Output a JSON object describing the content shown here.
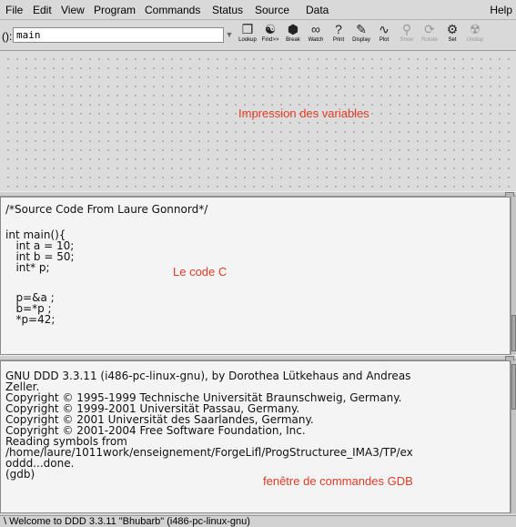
{
  "menubar": {
    "items": [
      "File",
      "Edit",
      "View",
      "Program",
      "Commands",
      "Status",
      "Source",
      "Data"
    ],
    "help": "Help"
  },
  "toolbar": {
    "arg_label": "():",
    "arg_value": "main",
    "buttons": [
      {
        "label": "Lookup",
        "icon": "magnifier-icon",
        "enabled": true
      },
      {
        "label": "Find>>",
        "icon": "binoculars-icon",
        "enabled": true
      },
      {
        "label": "Break",
        "icon": "stop-sign-icon",
        "enabled": true
      },
      {
        "label": "Watch",
        "icon": "glasses-icon",
        "enabled": true
      },
      {
        "label": "Print",
        "icon": "question-icon",
        "enabled": true
      },
      {
        "label": "Display",
        "icon": "display-icon",
        "enabled": true
      },
      {
        "label": "Plot",
        "icon": "plot-icon",
        "enabled": true
      },
      {
        "label": "Show",
        "icon": "show-icon",
        "enabled": false
      },
      {
        "label": "Rotate",
        "icon": "rotate-icon",
        "enabled": false
      },
      {
        "label": "Set",
        "icon": "set-icon",
        "enabled": true
      },
      {
        "label": "Undisp",
        "icon": "undisp-icon",
        "enabled": false
      }
    ]
  },
  "data_pane": {
    "annotation": "Impression des variables",
    "annotation_color": "#e23b24"
  },
  "source_pane": {
    "lines": [
      "/*Source Code From Laure Gonnord*/",
      "",
      "int main(){",
      "   int a = 10;",
      "   int b = 50;",
      "   int* p;",
      "",
      "   p=&a ;",
      "   b=*p ;",
      "   *p=42;"
    ],
    "annotation": "Le code C"
  },
  "console_pane": {
    "lines": [
      "GNU DDD 3.3.11 (i486-pc-linux-gnu), by Dorothea Lütkehaus and Andreas",
      "Zeller.",
      "Copyright © 1995-1999 Technische Universität Braunschweig, Germany.",
      "Copyright © 1999-2001 Universität Passau, Germany.",
      "Copyright © 2001 Universität des Saarlandes, Germany.",
      "Copyright © 2001-2004 Free Software Foundation, Inc.",
      "Reading symbols from",
      "/home/laure/1011work/enseignement/ForgeLifl/ProgStructuree_IMA3/TP/ex",
      "oddd...done.",
      "(gdb)"
    ],
    "annotation": "fenêtre de commandes GDB"
  },
  "statusbar": {
    "text": "\\ Welcome to DDD 3.3.11 \"Bhubarb\" (i486-pc-linux-gnu)"
  }
}
